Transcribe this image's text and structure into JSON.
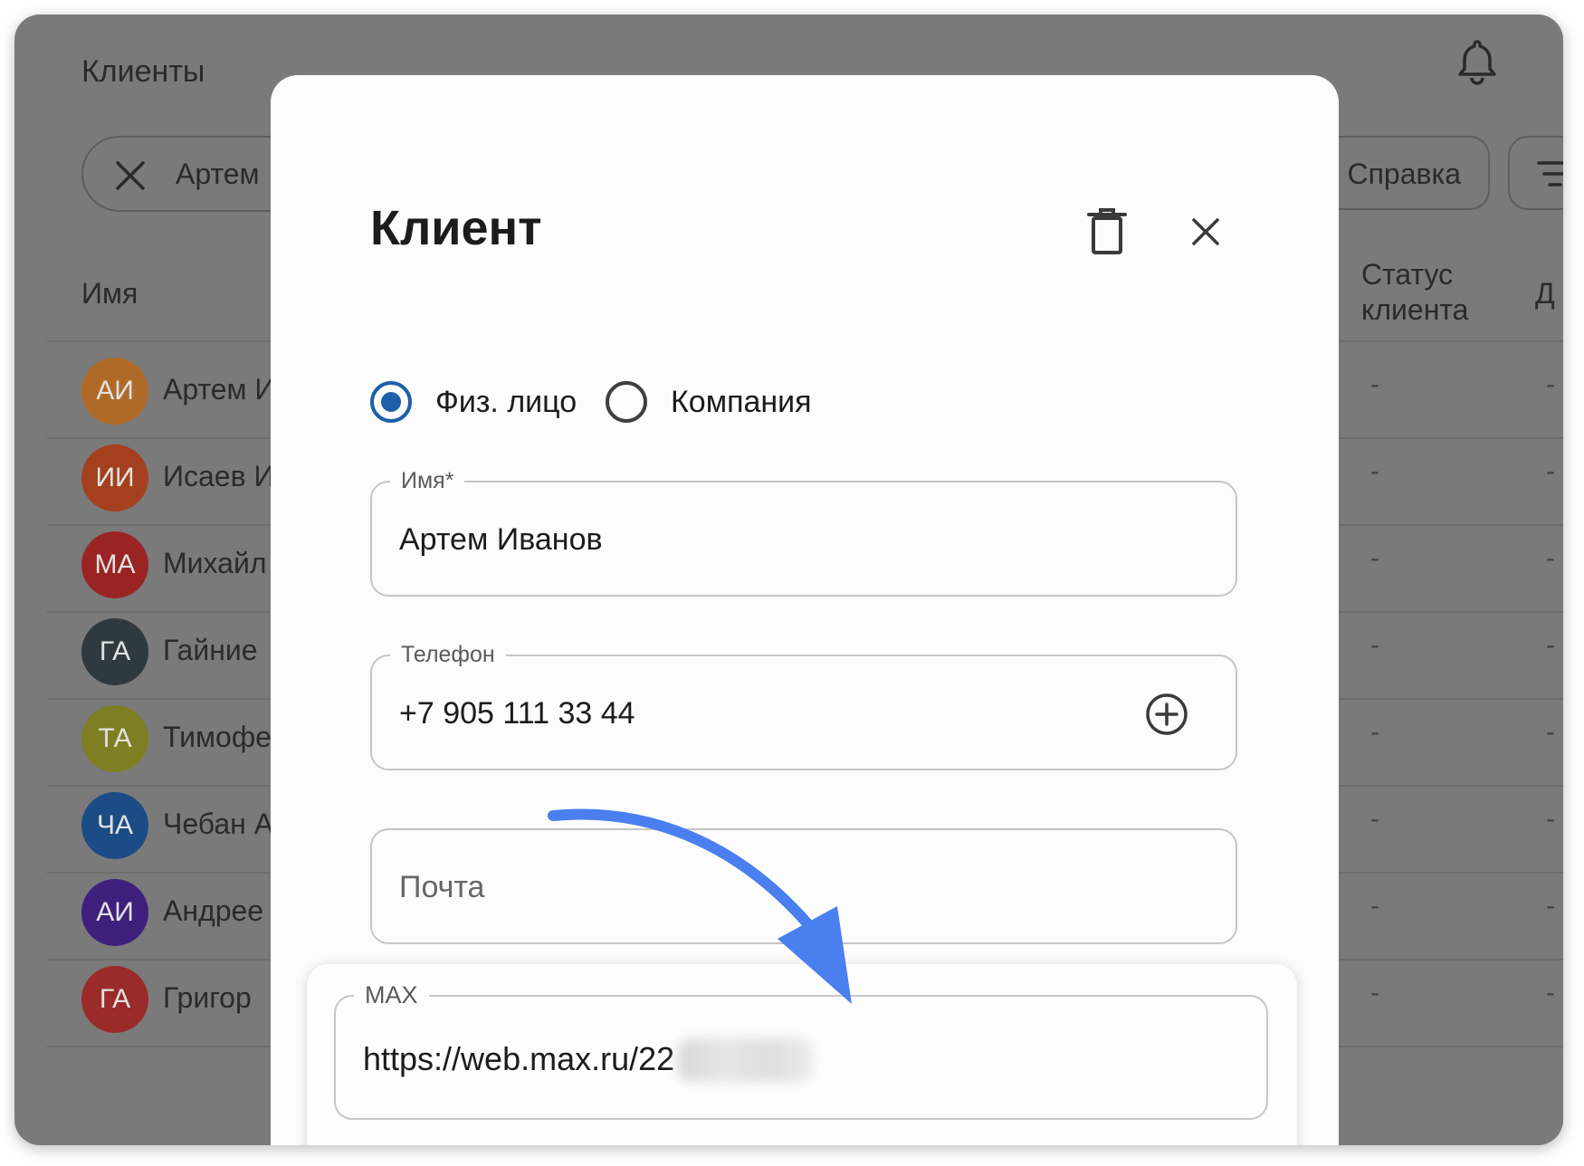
{
  "background": {
    "title": "Клиенты",
    "search_value": "Артем",
    "help_label": "Справка",
    "columns": {
      "name": "Имя",
      "status": "Статус клиента",
      "extra": "Д"
    },
    "rows": [
      {
        "initials": "АИ",
        "name": "Артем И",
        "color": "#b06a28",
        "status": "-",
        "extra": "-"
      },
      {
        "initials": "ИИ",
        "name": "Исаев И",
        "color": "#a5401e",
        "status": "-",
        "extra": "-"
      },
      {
        "initials": "МА",
        "name": "Михайл",
        "color": "#9a2424",
        "status": "-",
        "extra": "-"
      },
      {
        "initials": "ГА",
        "name": "Гайние",
        "color": "#2f3a40",
        "status": "-",
        "extra": "-"
      },
      {
        "initials": "ТА",
        "name": "Тимофе",
        "color": "#7d7f22",
        "status": "-",
        "extra": "-"
      },
      {
        "initials": "ЧА",
        "name": "Чебан А",
        "color": "#1c4c85",
        "status": "-",
        "extra": "-"
      },
      {
        "initials": "АИ",
        "name": "Андрее",
        "color": "#3f1f7c",
        "status": "-",
        "extra": "-"
      },
      {
        "initials": "ГА",
        "name": "Григор",
        "color": "#9b2a2a",
        "status": "-",
        "extra": "-"
      }
    ]
  },
  "modal": {
    "title": "Клиент",
    "radio_person": "Физ. лицо",
    "radio_company": "Компания",
    "selected_type": "Физ. лицо",
    "name_label": "Имя*",
    "name_value": "Артем Иванов",
    "phone_label": "Телефон",
    "phone_value": "+7 905 111 33 44",
    "email_placeholder": "Почта",
    "max_label": "MAX",
    "max_value": "https://web.max.ru/22"
  },
  "colors": {
    "accent": "#1d5fa8",
    "arrow": "#4a7ff0",
    "overlay": "#7a7a7a"
  },
  "icons": [
    "bell-icon",
    "close-icon",
    "filter-icon",
    "trash-icon",
    "plus-circle-icon",
    "arrow-annotation"
  ]
}
